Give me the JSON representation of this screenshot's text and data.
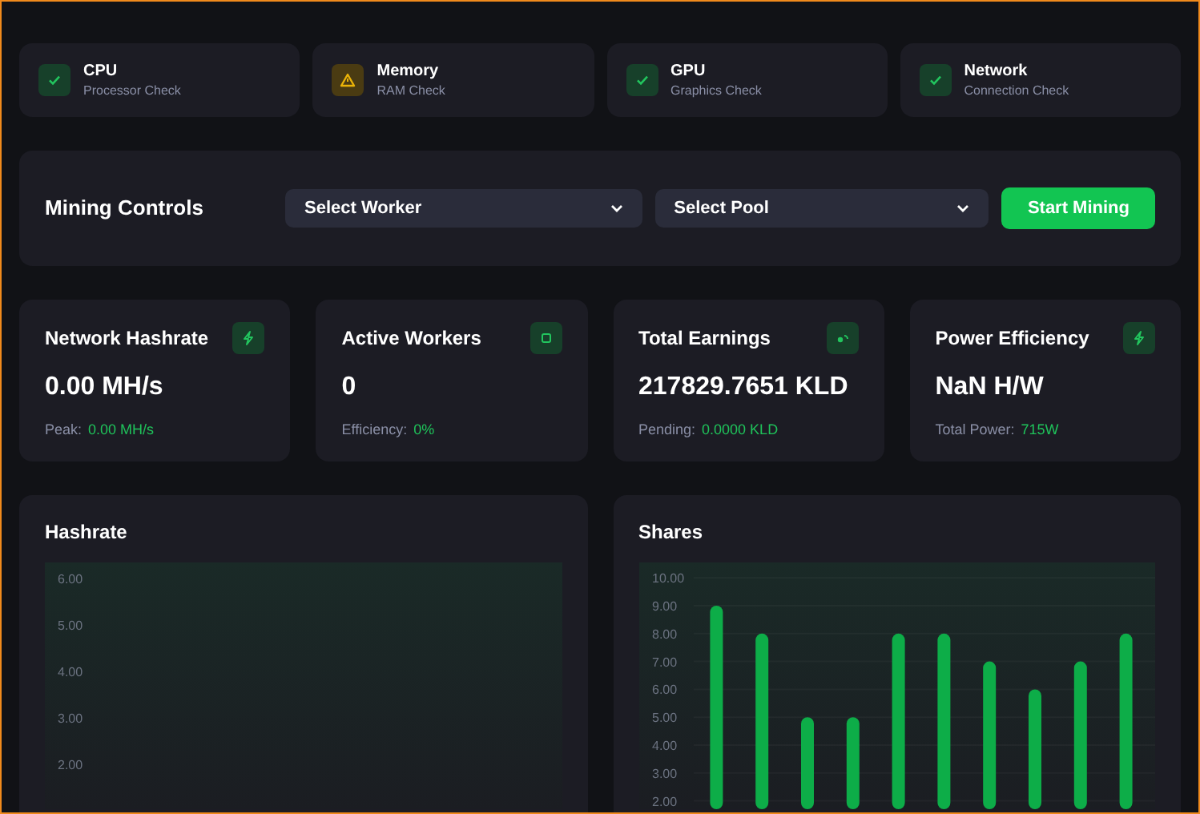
{
  "system_checks": [
    {
      "title": "CPU",
      "subtitle": "Processor Check",
      "kind": "ok"
    },
    {
      "title": "Memory",
      "subtitle": "RAM Check",
      "kind": "warning"
    },
    {
      "title": "GPU",
      "subtitle": "Graphics Check",
      "kind": "ok"
    },
    {
      "title": "Network",
      "subtitle": "Connection Check",
      "kind": "ok"
    }
  ],
  "mining_controls": {
    "title": "Mining Controls",
    "worker_select": "Select Worker",
    "pool_select": "Select Pool",
    "start_button": "Start Mining"
  },
  "stats": [
    {
      "title": "Network Hashrate",
      "value": "0.00 MH/s",
      "detail_label": "Peak:",
      "detail_value": "0.00 MH/s"
    },
    {
      "title": "Active Workers",
      "value": "0",
      "detail_label": "Efficiency:",
      "detail_value": "0%"
    },
    {
      "title": "Total Earnings",
      "value": "217829.7651 KLD",
      "detail_label": "Pending:",
      "detail_value": "0.0000 KLD"
    },
    {
      "title": "Power Efficiency",
      "value": "NaN H/W",
      "detail_label": "Total Power:",
      "detail_value": "715W"
    }
  ],
  "hashrate_chart": {
    "title": "Hashrate",
    "axis_labels": [
      "6.00",
      "5.00",
      "4.00",
      "3.00",
      "2.00"
    ]
  },
  "shares_chart": {
    "title": "Shares",
    "chart_data": {
      "type": "bar",
      "grid": true,
      "categories": [
        null,
        null,
        null,
        null,
        null,
        null,
        null,
        null,
        null,
        null
      ],
      "ylim": [
        1.7,
        10.55
      ],
      "yticks": [
        {
          "value": 2,
          "label": "2.00"
        },
        {
          "value": 3,
          "label": "3.00"
        },
        {
          "value": 4,
          "label": "4.00"
        },
        {
          "value": 5,
          "label": "5.00"
        },
        {
          "value": 6,
          "label": "6.00"
        },
        {
          "value": 7,
          "label": "7.00"
        },
        {
          "value": 8,
          "label": "8.00"
        },
        {
          "value": 9,
          "label": "9.00"
        },
        {
          "value": 10,
          "label": "10.00"
        }
      ],
      "values": [
        9,
        8,
        5,
        5,
        8,
        8,
        7,
        6,
        7,
        8
      ]
    }
  }
}
